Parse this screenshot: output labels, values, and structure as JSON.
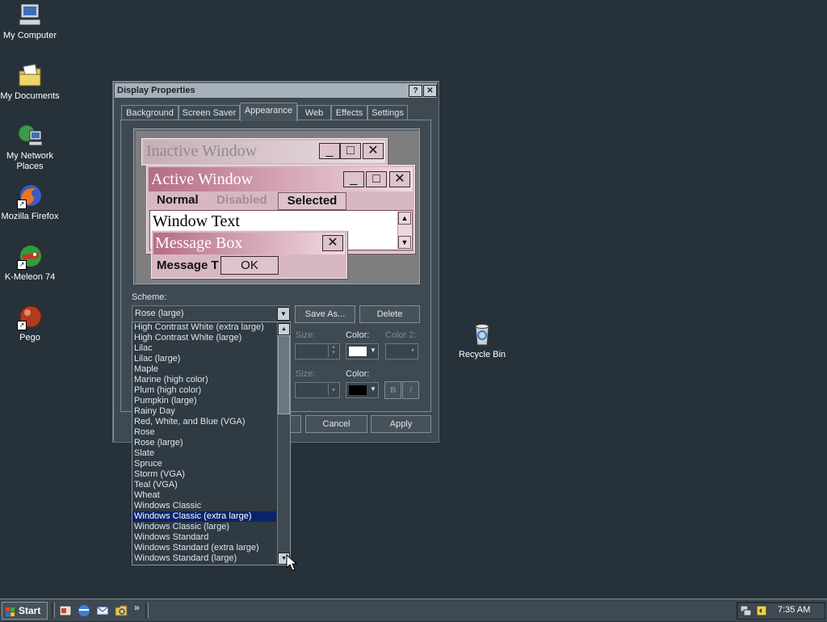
{
  "desktop": {
    "icons": [
      {
        "label": "My Computer"
      },
      {
        "label": "My Documents"
      },
      {
        "label": "My Network Places"
      },
      {
        "label": "Mozilla Firefox"
      },
      {
        "label": "K-Meleon 74"
      },
      {
        "label": "Pego"
      },
      {
        "label": "Recycle Bin"
      }
    ]
  },
  "dialog": {
    "title": "Display Properties",
    "help_glyph": "?",
    "close_glyph": "✕",
    "tabs": [
      "Background",
      "Screen Saver",
      "Appearance",
      "Web",
      "Effects",
      "Settings"
    ],
    "active_tab": "Appearance",
    "preview": {
      "inactive_title": "Inactive Window",
      "active_title": "Active Window",
      "menu_normal": "Normal",
      "menu_disabled": "Disabled",
      "menu_selected": "Selected",
      "window_text": "Window Text",
      "message_box_title": "Message Box",
      "message_text": "Message T",
      "ok_label": "OK"
    },
    "scheme_label": "Scheme:",
    "scheme_value": "Rose (large)",
    "save_as_label": "Save As...",
    "delete_label": "Delete",
    "size_label": "Size:",
    "color_label": "Color:",
    "color2_label": "Color 2:",
    "size_label_2": "Size:",
    "color_label_2": "Color:",
    "bold_label": "B",
    "italic_label": "I",
    "cancel_label": "Cancel",
    "apply_label": "Apply",
    "scheme_list": [
      "High Contrast White (extra large)",
      "High Contrast White (large)",
      "Lilac",
      "Lilac (large)",
      "Maple",
      "Marine (high color)",
      "Plum (high color)",
      "Pumpkin (large)",
      "Rainy Day",
      "Red, White, and Blue (VGA)",
      "Rose",
      "Rose (large)",
      "Slate",
      "Spruce",
      "Storm (VGA)",
      "Teal (VGA)",
      "Wheat",
      "Windows Classic",
      "Windows Classic (extra large)",
      "Windows Classic (large)",
      "Windows Standard",
      "Windows Standard (extra large)",
      "Windows Standard (large)"
    ],
    "selected_scheme": "Windows Classic (extra large)"
  },
  "taskbar": {
    "start_label": "Start",
    "more_glyph": "»",
    "clock": "7:35 AM"
  },
  "colors": {
    "desktop": "#27313a",
    "dialog_face": "#3e4952",
    "rose_face": "#d7b7c3",
    "selection": "#0a246a"
  }
}
